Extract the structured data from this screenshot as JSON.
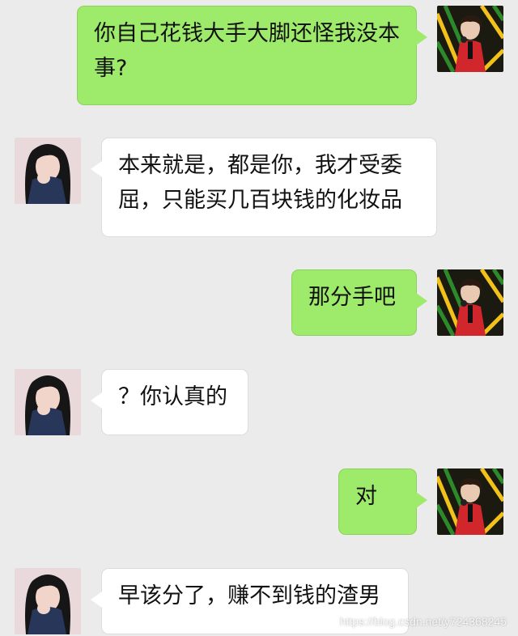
{
  "messages": [
    {
      "side": "right",
      "sender": "male-avatar",
      "text": "你自己花钱大手大脚还怪我没本事?"
    },
    {
      "side": "left",
      "sender": "female-avatar",
      "text": "本来就是，都是你，我才受委屈，只能买几百块钱的化妆品"
    },
    {
      "side": "right",
      "sender": "male-avatar",
      "text": "那分手吧"
    },
    {
      "side": "left",
      "sender": "female-avatar",
      "text": "？你认真的"
    },
    {
      "side": "right",
      "sender": "male-avatar",
      "text": "对"
    },
    {
      "side": "left",
      "sender": "female-avatar",
      "text": "早该分了，赚不到钱的渣男"
    }
  ],
  "watermark": "https://blog.csdn.net/y724368245",
  "colors": {
    "background": "#ebebeb",
    "outgoing_bubble": "#9eea6a",
    "incoming_bubble": "#ffffff"
  }
}
